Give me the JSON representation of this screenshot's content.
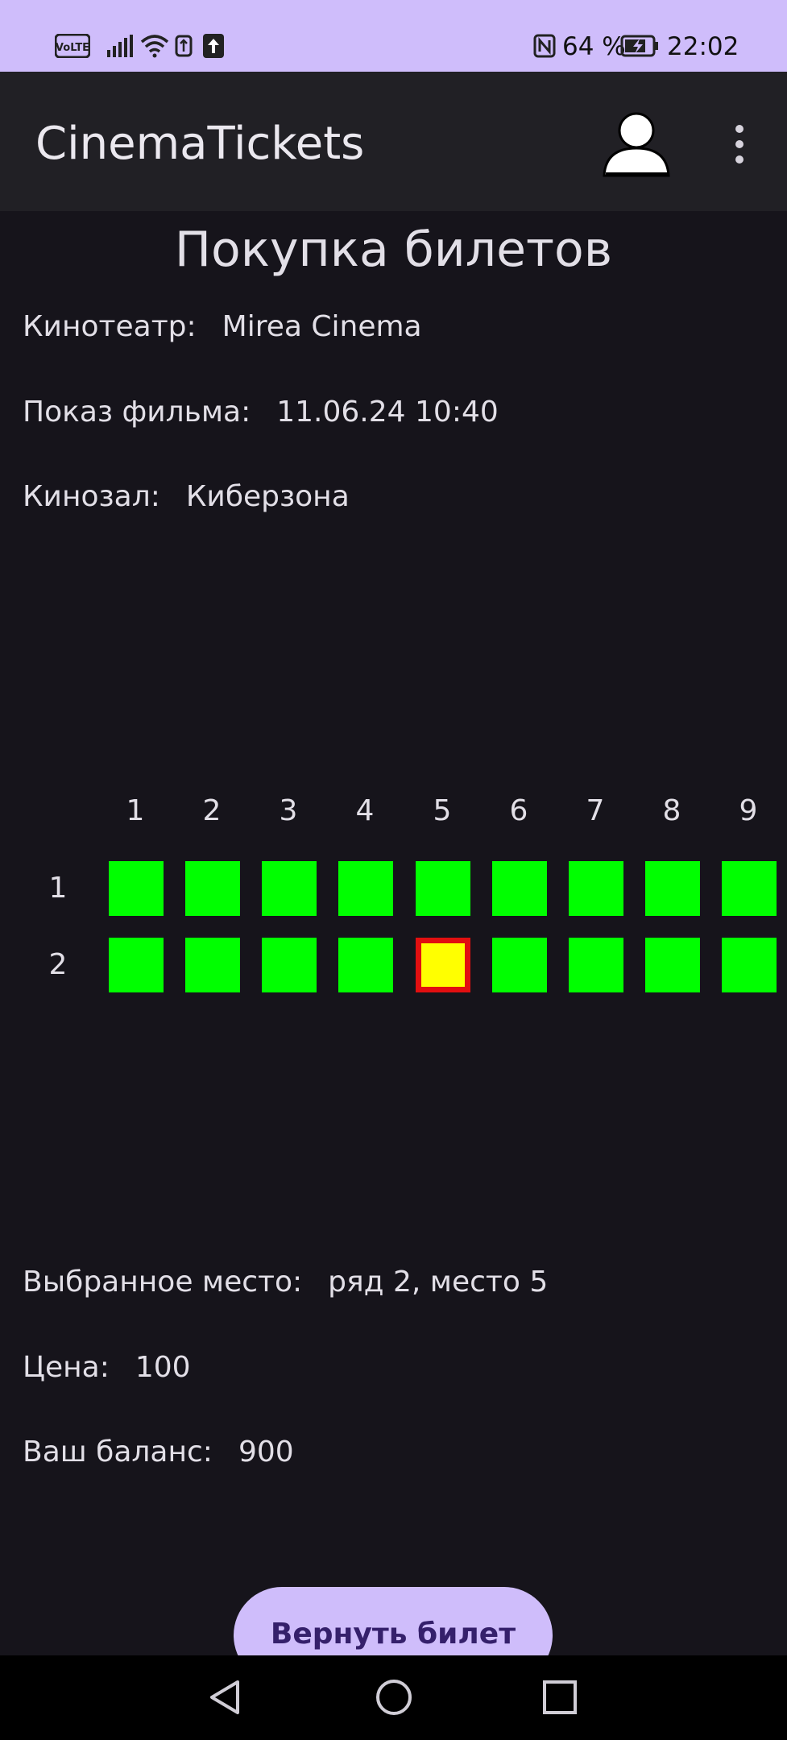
{
  "status_bar": {
    "volte_label": "VoLTE",
    "nfc_label": "N",
    "battery_percent": "64 %",
    "time": "22:02"
  },
  "app_bar": {
    "title": "CinemaTickets",
    "icons": [
      "profile-icon",
      "more-vert-icon"
    ]
  },
  "page": {
    "title": "Покупка билетов",
    "cinema_label": "Кинотеатр:",
    "cinema_value": "Mirea Cinema",
    "showing_label": "Показ фильма:",
    "showing_value": "11.06.24 10:40",
    "hall_label": "Кинозал:",
    "hall_value": "Киберзона"
  },
  "seats": {
    "columns": [
      "1",
      "2",
      "3",
      "4",
      "5",
      "6",
      "7",
      "8",
      "9"
    ],
    "rows": [
      "1",
      "2"
    ],
    "selected": {
      "row": 2,
      "seat": 5
    },
    "colors": {
      "free": "#00ff00",
      "selected_fill": "#ffff00",
      "selected_border": "#e20f10"
    }
  },
  "summary": {
    "selected_label": "Выбранное место:",
    "selected_value": "ряд 2, место 5",
    "price_label": "Цена:",
    "price_value": "100",
    "balance_label": "Ваш баланс:",
    "balance_value": "900"
  },
  "actions": {
    "return_label": "Вернуть билет"
  },
  "nav_bar": {
    "icons": [
      "back-icon",
      "home-icon",
      "recents-icon"
    ]
  }
}
